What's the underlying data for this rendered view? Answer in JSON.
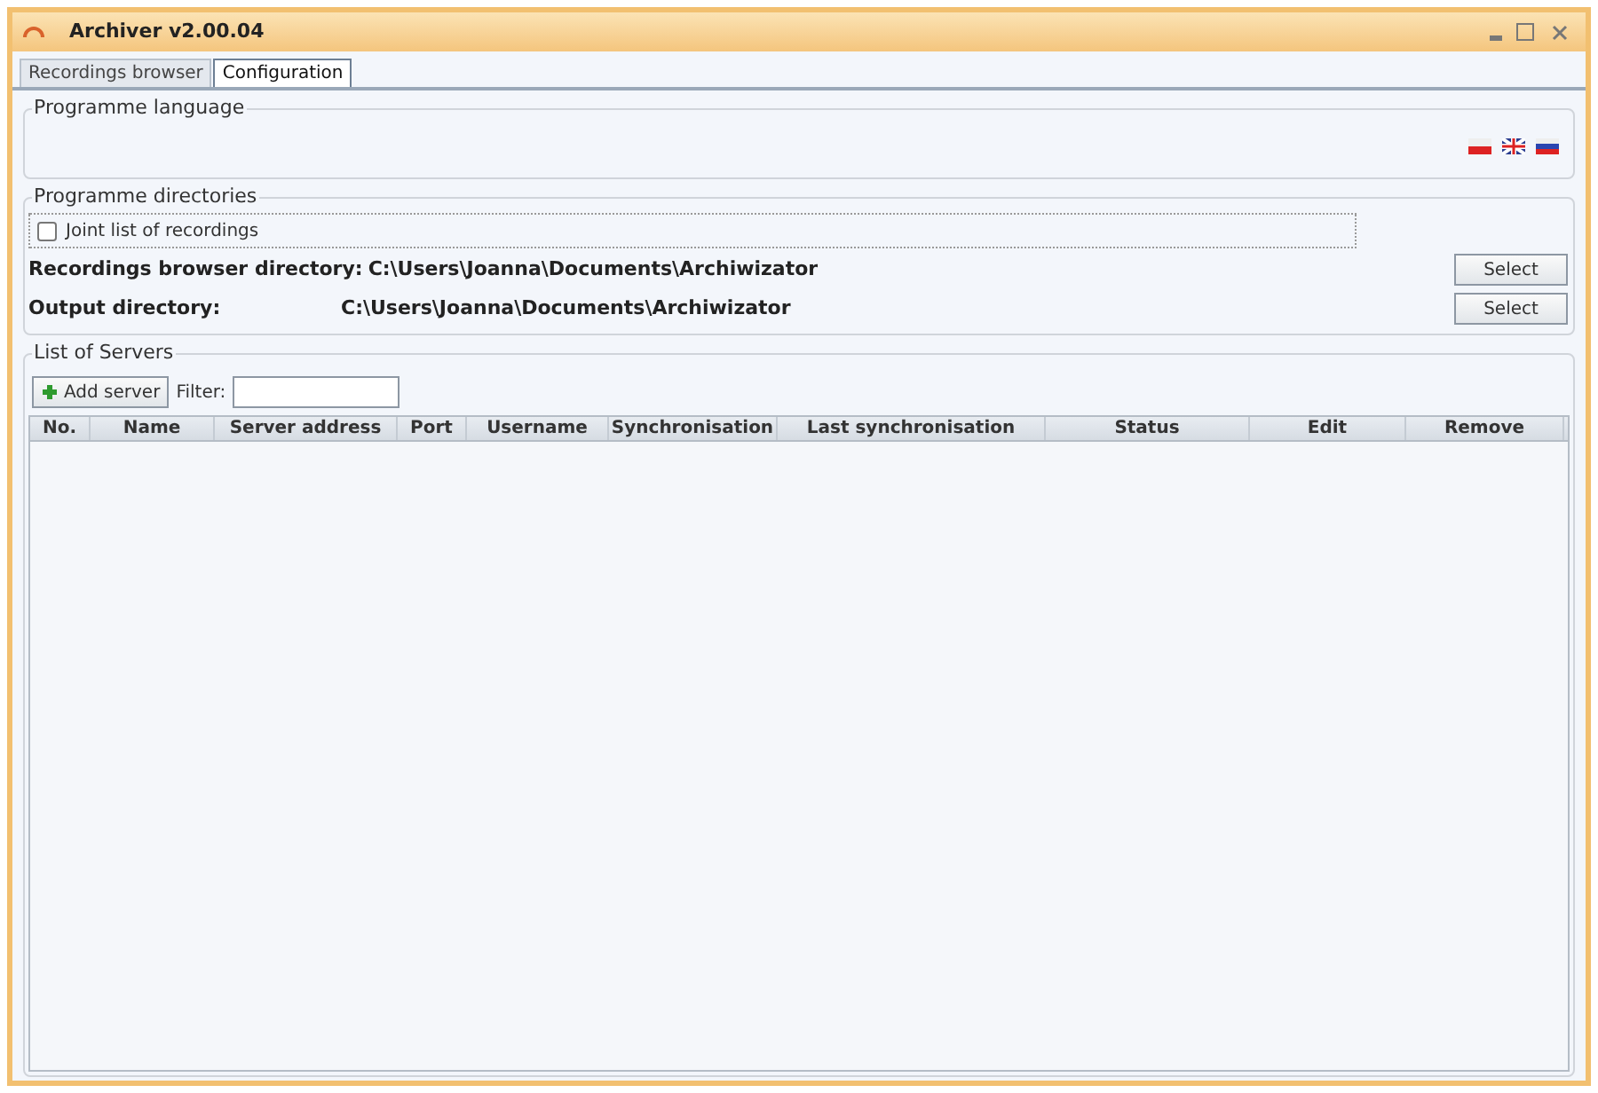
{
  "window": {
    "title": "Archiver v2.00.04"
  },
  "tabs": [
    {
      "label": "Recordings browser",
      "selected": false
    },
    {
      "label": "Configuration",
      "selected": true
    }
  ],
  "language_group": {
    "title": "Programme language"
  },
  "directories_group": {
    "title": "Programme directories",
    "joint_list": {
      "label": "Joint list of recordings",
      "checked": false
    },
    "rows": [
      {
        "label": "Recordings browser directory:",
        "path": "C:\\Users\\Joanna\\Documents\\Archiwizator",
        "button": "Select"
      },
      {
        "label": "Output directory:",
        "path": "C:\\Users\\Joanna\\Documents\\Archiwizator",
        "button": "Select"
      }
    ]
  },
  "servers_group": {
    "title": "List of Servers",
    "add_button": "Add server",
    "filter_label": "Filter:",
    "columns": [
      "No.",
      "Name",
      "Server address",
      "Port",
      "Username",
      "Synchronisation",
      "Last synchronisation",
      "Status",
      "Edit",
      "Remove"
    ]
  }
}
